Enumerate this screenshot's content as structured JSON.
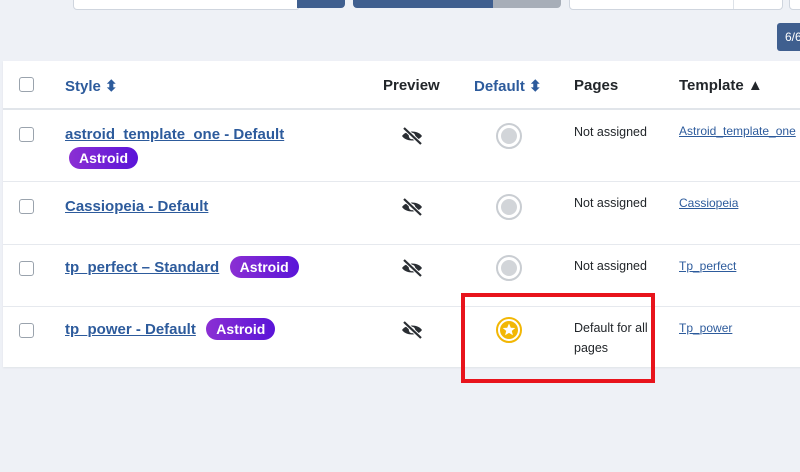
{
  "results_count": "6/6",
  "table": {
    "headers": {
      "style": "Style ⬍",
      "preview": "Preview",
      "default": "Default ⬍",
      "pages": "Pages",
      "template": "Template ▲"
    },
    "rows": [
      {
        "style": "astroid_template_one - Default",
        "badge": "Astroid",
        "default_state": "not-default",
        "pages": "Not assigned",
        "template": "Astroid_template_one"
      },
      {
        "style": "Cassiopeia - Default",
        "badge": "",
        "default_state": "not-default",
        "pages": "Not assigned",
        "template": "Cassiopeia"
      },
      {
        "style": "tp_perfect – Standard",
        "badge": "Astroid",
        "default_state": "not-default",
        "pages": "Not assigned",
        "template": "Tp_perfect"
      },
      {
        "style": "tp_power - Default",
        "badge": "Astroid",
        "default_state": "default",
        "pages": "Default for all pages",
        "template": "Tp_power"
      }
    ]
  },
  "colors": {
    "link": "#2d5b9c",
    "badge_start": "#8b2fd3",
    "badge_end": "#5a14d8",
    "default_star": "#f2b705",
    "highlight": "#e8141c"
  },
  "icons": {
    "preview": "eye-slash-icon",
    "not_default": "circle-icon",
    "default": "star-icon"
  }
}
